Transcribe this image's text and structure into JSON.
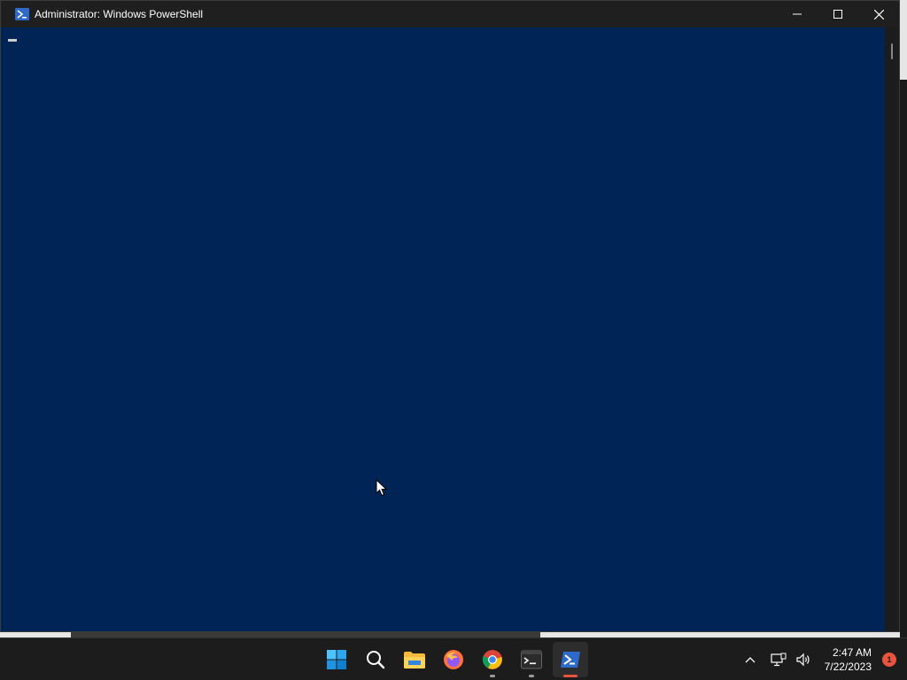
{
  "window": {
    "title": "Administrator: Windows PowerShell",
    "console_background": "#012456"
  },
  "title_controls": {
    "minimize_icon": "minimize-icon",
    "maximize_icon": "maximize-icon",
    "close_icon": "close-icon"
  },
  "taskbar": {
    "apps": [
      {
        "name": "start-button",
        "icon": "windows-logo-icon"
      },
      {
        "name": "search-button",
        "icon": "search-icon"
      },
      {
        "name": "file-explorer",
        "icon": "folder-icon"
      },
      {
        "name": "firefox",
        "icon": "firefox-icon"
      },
      {
        "name": "chrome",
        "icon": "chrome-icon"
      },
      {
        "name": "terminal",
        "icon": "terminal-icon"
      },
      {
        "name": "powershell",
        "icon": "powershell-icon",
        "active": true
      }
    ],
    "tray": {
      "time": "2:47 AM",
      "date": "7/22/2023",
      "notification_count": "1"
    }
  },
  "colors": {
    "taskbar_bg": "#1c1c1c",
    "accent_active": "#e8553e",
    "windows_blue": "#0078d4"
  }
}
